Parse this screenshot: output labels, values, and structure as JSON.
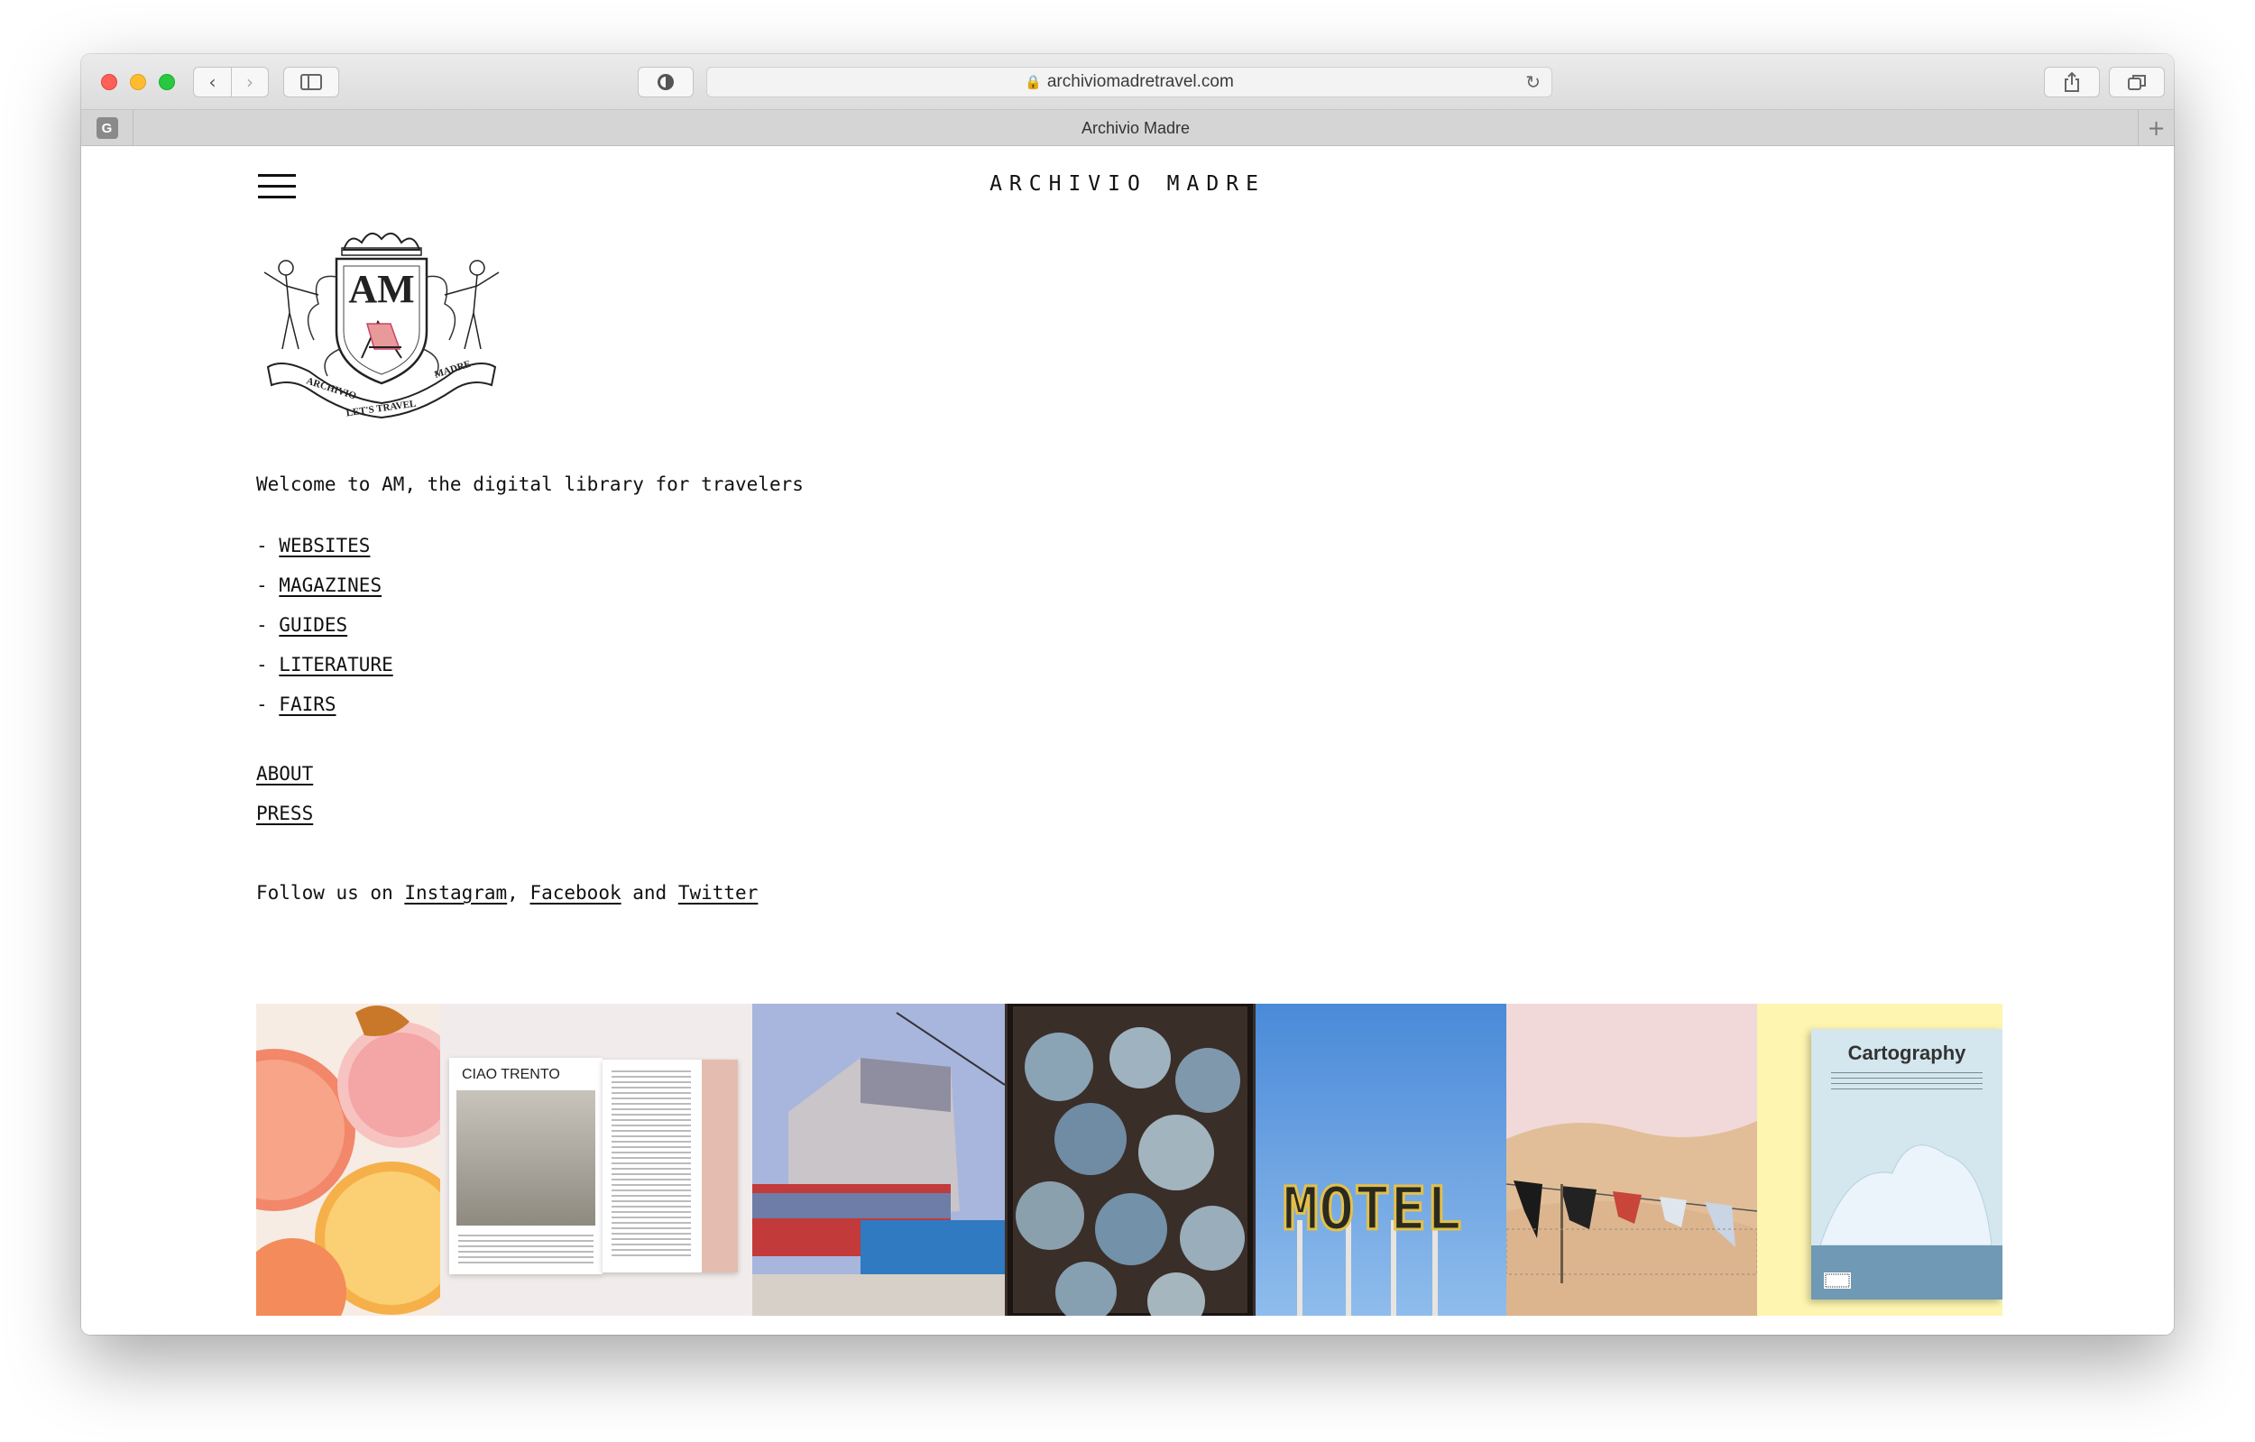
{
  "browser": {
    "url": "archiviomadretravel.com",
    "tab_title": "Archivio Madre",
    "favicon_letter": "G"
  },
  "site": {
    "title": "ARCHIVIO MADRE",
    "logo": {
      "monogram": "AM",
      "banner_left": "ARCHIVIO",
      "banner_right": "MADRE",
      "banner_bottom": "LET'S TRAVEL"
    },
    "welcome": "Welcome to AM, the digital library for travelers",
    "categories": [
      {
        "label": "WEBSITES"
      },
      {
        "label": "MAGAZINES"
      },
      {
        "label": "GUIDES"
      },
      {
        "label": "LITERATURE"
      },
      {
        "label": "FAIRS"
      }
    ],
    "list_prefix": "- ",
    "about": "ABOUT",
    "press": "PRESS",
    "follow": {
      "prefix": "Follow us on ",
      "instagram": "Instagram",
      "sep1": ", ",
      "facebook": "Facebook",
      "sep2": " and ",
      "twitter": "Twitter"
    },
    "gallery": {
      "magazine_headline": "CIAO TRENTO",
      "motel_sign": "MOTEL",
      "cover_title": "Cartography"
    }
  },
  "colors": {
    "accent_pink": "#e89a9a",
    "text": "#111111"
  }
}
